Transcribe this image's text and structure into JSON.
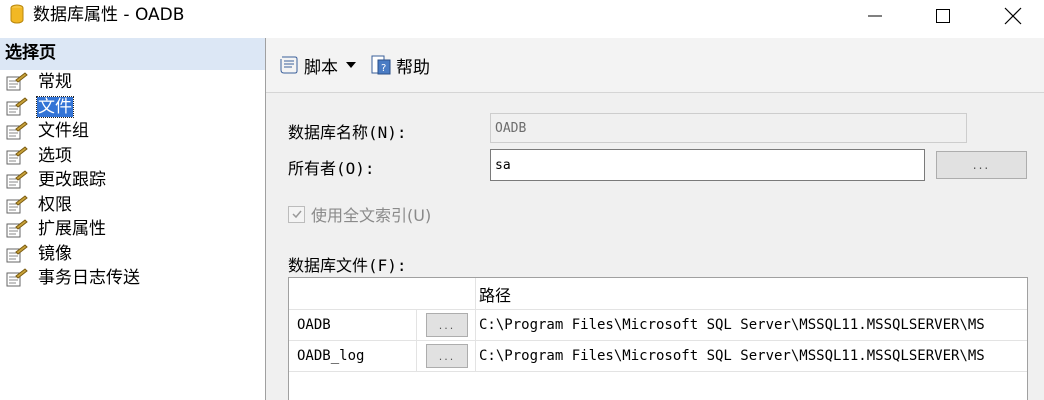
{
  "window": {
    "title": "数据库属性 - OADB",
    "controls": {
      "minimize": "minimize-icon",
      "maximize": "maximize-icon",
      "close": "close-icon"
    }
  },
  "sidebar": {
    "header": "选择页",
    "items": [
      {
        "label": "常规",
        "active": false
      },
      {
        "label": "文件",
        "active": true
      },
      {
        "label": "文件组",
        "active": false
      },
      {
        "label": "选项",
        "active": false
      },
      {
        "label": "更改跟踪",
        "active": false
      },
      {
        "label": "权限",
        "active": false
      },
      {
        "label": "扩展属性",
        "active": false
      },
      {
        "label": "镜像",
        "active": false
      },
      {
        "label": "事务日志传送",
        "active": false
      }
    ]
  },
  "toolbar": {
    "script_label": "脚本",
    "help_label": "帮助"
  },
  "form": {
    "db_name_label": "数据库名称(N):",
    "db_name_value": "OADB",
    "owner_label": "所有者(O):",
    "owner_value": "sa",
    "owner_browse": "...",
    "fulltext_label": "使用全文索引(U)",
    "fulltext_checked": true,
    "files_label": "数据库文件(F):"
  },
  "files_table": {
    "path_header": "路径",
    "rows": [
      {
        "name": "OADB",
        "button": "...",
        "path": "C:\\Program Files\\Microsoft SQL Server\\MSSQL11.MSSQLSERVER\\MS"
      },
      {
        "name": "OADB_log",
        "button": "...",
        "path": "C:\\Program Files\\Microsoft SQL Server\\MSSQL11.MSSQLSERVER\\MS"
      }
    ]
  },
  "colors": {
    "selection": "#3374d6",
    "sidebar_header": "#dce7f5",
    "panel": "#f0f0f0"
  }
}
